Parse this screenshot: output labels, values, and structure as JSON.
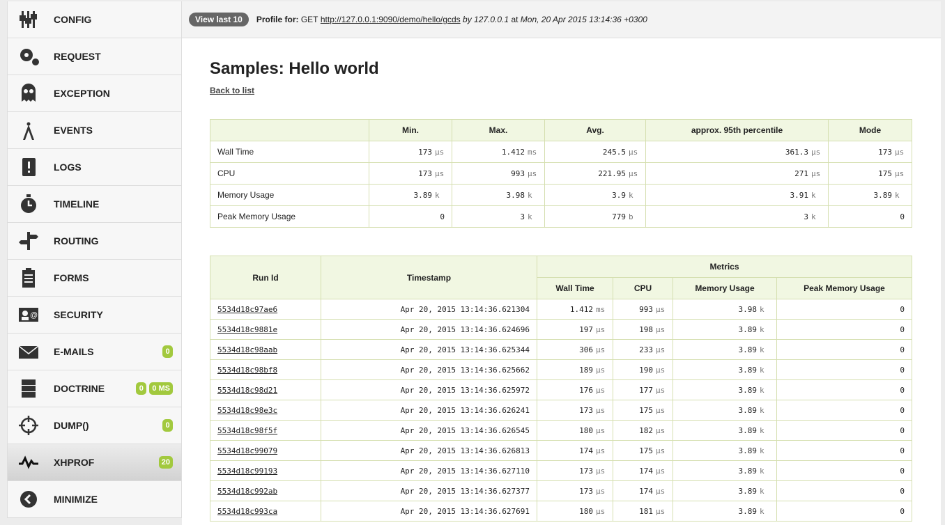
{
  "sidebar": {
    "items": [
      {
        "label": "CONFIG",
        "icon": "config-icon",
        "badges": []
      },
      {
        "label": "REQUEST",
        "icon": "gears-icon",
        "badges": []
      },
      {
        "label": "EXCEPTION",
        "icon": "ghost-icon",
        "badges": []
      },
      {
        "label": "EVENTS",
        "icon": "antenna-icon",
        "badges": []
      },
      {
        "label": "LOGS",
        "icon": "log-book-icon",
        "badges": []
      },
      {
        "label": "TIMELINE",
        "icon": "stopwatch-icon",
        "badges": []
      },
      {
        "label": "ROUTING",
        "icon": "signpost-icon",
        "badges": []
      },
      {
        "label": "FORMS",
        "icon": "clipboard-icon",
        "badges": []
      },
      {
        "label": "SECURITY",
        "icon": "user-card-icon",
        "badges": []
      },
      {
        "label": "E-MAILS",
        "icon": "envelope-icon",
        "badges": [
          "0"
        ]
      },
      {
        "label": "DOCTRINE",
        "icon": "database-icon",
        "badges": [
          "0",
          "0 MS"
        ]
      },
      {
        "label": "DUMP()",
        "icon": "crosshair-icon",
        "badges": [
          "0"
        ]
      },
      {
        "label": "XHPROF",
        "icon": "pulse-icon",
        "badges": [
          "20"
        ],
        "active": true
      },
      {
        "label": "MINIMIZE",
        "icon": "chevron-left-circle-icon",
        "badges": []
      }
    ]
  },
  "header": {
    "view_last": "View last 10",
    "profile_for": "Profile for:",
    "method": "GET",
    "url": "http://127.0.0.1:9090/demo/hello/gcds",
    "by": "by",
    "ip": "127.0.0.1",
    "at": "at",
    "date": "Mon, 20 Apr 2015 13:14:36 +0300"
  },
  "main": {
    "title": "Samples: Hello world",
    "back": "Back to list",
    "summary": {
      "headers": [
        "",
        "Min.",
        "Max.",
        "Avg.",
        "approx. 95th percentile",
        "Mode"
      ],
      "rows": [
        {
          "label": "Wall Time",
          "cells": [
            [
              "173",
              "µs"
            ],
            [
              "1.412",
              "ms"
            ],
            [
              "245.5",
              "µs"
            ],
            [
              "361.3",
              "µs"
            ],
            [
              "173",
              "µs"
            ]
          ]
        },
        {
          "label": "CPU",
          "cells": [
            [
              "173",
              "µs"
            ],
            [
              "993",
              "µs"
            ],
            [
              "221.95",
              "µs"
            ],
            [
              "271",
              "µs"
            ],
            [
              "175",
              "µs"
            ]
          ]
        },
        {
          "label": "Memory Usage",
          "cells": [
            [
              "3.89",
              "k"
            ],
            [
              "3.98",
              "k"
            ],
            [
              "3.9",
              "k"
            ],
            [
              "3.91",
              "k"
            ],
            [
              "3.89",
              "k"
            ]
          ]
        },
        {
          "label": "Peak Memory Usage",
          "cells": [
            [
              "0",
              ""
            ],
            [
              "3",
              "k"
            ],
            [
              "779",
              "b"
            ],
            [
              "3",
              "k"
            ],
            [
              "0",
              ""
            ]
          ]
        }
      ]
    },
    "runs": {
      "h_run": "Run Id",
      "h_ts": "Timestamp",
      "h_metrics": "Metrics",
      "h_wall": "Wall Time",
      "h_cpu": "CPU",
      "h_mem": "Memory Usage",
      "h_peak": "Peak Memory Usage",
      "rows": [
        [
          "5534d18c97ae6",
          "Apr 20, 2015 13:14:36.621304",
          "1.412",
          "ms",
          "993",
          "3.98",
          "0"
        ],
        [
          "5534d18c9881e",
          "Apr 20, 2015 13:14:36.624696",
          "197",
          "µs",
          "198",
          "3.89",
          "0"
        ],
        [
          "5534d18c98aab",
          "Apr 20, 2015 13:14:36.625344",
          "306",
          "µs",
          "233",
          "3.89",
          "0"
        ],
        [
          "5534d18c98bf8",
          "Apr 20, 2015 13:14:36.625662",
          "189",
          "µs",
          "190",
          "3.89",
          "0"
        ],
        [
          "5534d18c98d21",
          "Apr 20, 2015 13:14:36.625972",
          "176",
          "µs",
          "177",
          "3.89",
          "0"
        ],
        [
          "5534d18c98e3c",
          "Apr 20, 2015 13:14:36.626241",
          "173",
          "µs",
          "175",
          "3.89",
          "0"
        ],
        [
          "5534d18c98f5f",
          "Apr 20, 2015 13:14:36.626545",
          "180",
          "µs",
          "182",
          "3.89",
          "0"
        ],
        [
          "5534d18c99079",
          "Apr 20, 2015 13:14:36.626813",
          "174",
          "µs",
          "175",
          "3.89",
          "0"
        ],
        [
          "5534d18c99193",
          "Apr 20, 2015 13:14:36.627110",
          "173",
          "µs",
          "174",
          "3.89",
          "0"
        ],
        [
          "5534d18c992ab",
          "Apr 20, 2015 13:14:36.627377",
          "173",
          "µs",
          "174",
          "3.89",
          "0"
        ],
        [
          "5534d18c993ca",
          "Apr 20, 2015 13:14:36.627691",
          "180",
          "µs",
          "181",
          "3.89",
          "0"
        ]
      ],
      "cpu_unit": "µs",
      "mem_unit": "k"
    }
  }
}
